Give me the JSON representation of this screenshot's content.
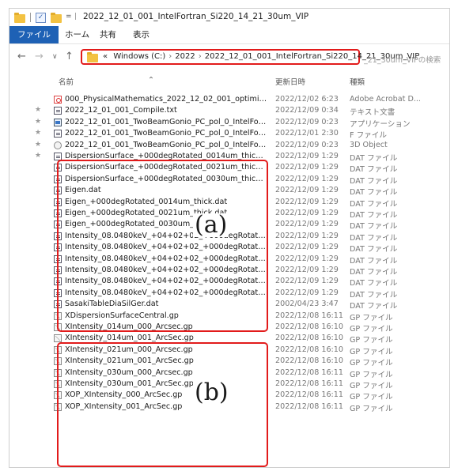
{
  "window": {
    "title": "2022_12_01_001_IntelFortran_Si220_14_21_30um_VIP",
    "quick_access_sep": "|",
    "quick_access_arrow": "="
  },
  "ribbon": {
    "tabs": [
      {
        "label": "ファイル",
        "active": true
      },
      {
        "label": "ホーム",
        "active": false
      },
      {
        "label": "共有",
        "active": false
      },
      {
        "label": "表示",
        "active": false
      }
    ]
  },
  "nav": {
    "back_icon": "←",
    "forward_icon": "→",
    "recent_icon": "∨",
    "up_icon": "↑",
    "address": {
      "overflow": "«",
      "segments": [
        "Windows (C:)",
        "2022",
        "2022_12_01_001_IntelFortran_Si220_14_21_30um_VIP"
      ],
      "separator": "›"
    },
    "search_placeholder": "_21_30um_VIPの検索"
  },
  "columns": {
    "name": "名前",
    "date": "更新日時",
    "type": "種類"
  },
  "files": [
    {
      "name": "000_PhysicalMathematics_2022_12_02_001_optimized.pdf",
      "date": "2022/12/02 6:23",
      "type": "Adobe Acrobat D...",
      "icon": "pdf-icon",
      "pinned": false
    },
    {
      "name": "2022_12_01_001_Compile.txt",
      "date": "2022/12/09 0:34",
      "type": "テキスト文書",
      "icon": "txt-icon",
      "pinned": true
    },
    {
      "name": "2022_12_01_001_TwoBeamGonio_PC_pol_0_IntelFortMKL.exe",
      "date": "2022/12/09 0:23",
      "type": "アプリケーション",
      "icon": "exe-icon",
      "pinned": true
    },
    {
      "name": "2022_12_01_001_TwoBeamGonio_PC_pol_0_IntelFortMKL.f",
      "date": "2022/12/01 2:30",
      "type": "F ファイル",
      "icon": "f-icon",
      "pinned": true
    },
    {
      "name": "2022_12_01_001_TwoBeamGonio_PC_pol_0_IntelFortMKL.obj",
      "date": "2022/12/09 0:23",
      "type": "3D Object",
      "icon": "obj-icon",
      "pinned": true
    },
    {
      "name": "DispersionSurface_+000degRotated_0014um_thick.dat",
      "date": "2022/12/09 1:29",
      "type": "DAT ファイル",
      "icon": "dat-icon",
      "pinned": true
    },
    {
      "name": "DispersionSurface_+000degRotated_0021um_thick.dat",
      "date": "2022/12/09 1:29",
      "type": "DAT ファイル",
      "icon": "dat-icon",
      "pinned": false
    },
    {
      "name": "DispersionSurface_+000degRotated_0030um_thick.dat",
      "date": "2022/12/09 1:29",
      "type": "DAT ファイル",
      "icon": "dat-icon",
      "pinned": false
    },
    {
      "name": "Eigen.dat",
      "date": "2022/12/09 1:29",
      "type": "DAT ファイル",
      "icon": "dat-icon",
      "pinned": false
    },
    {
      "name": "Eigen_+000degRotated_0014um_thick.dat",
      "date": "2022/12/09 1:29",
      "type": "DAT ファイル",
      "icon": "dat-icon",
      "pinned": false
    },
    {
      "name": "Eigen_+000degRotated_0021um_thick.dat",
      "date": "2022/12/09 1:29",
      "type": "DAT ファイル",
      "icon": "dat-icon",
      "pinned": false
    },
    {
      "name": "Eigen_+000degRotated_0030um_thick.dat",
      "date": "2022/12/09 1:29",
      "type": "DAT ファイル",
      "icon": "dat-icon",
      "pinned": false
    },
    {
      "name": "Intensity_08.0480keV_+04+02+02_+000degRotated_0014um_t...",
      "date": "2022/12/09 1:29",
      "type": "DAT ファイル",
      "icon": "dat-icon",
      "pinned": false
    },
    {
      "name": "Intensity_08.0480keV_+04+02+02_+000degRotated_0014um_t...",
      "date": "2022/12/09 1:29",
      "type": "DAT ファイル",
      "icon": "dat-icon",
      "pinned": false
    },
    {
      "name": "Intensity_08.0480keV_+04+02+02_+000degRotated_0021um_t...",
      "date": "2022/12/09 1:29",
      "type": "DAT ファイル",
      "icon": "dat-icon",
      "pinned": false
    },
    {
      "name": "Intensity_08.0480keV_+04+02+02_+000degRotated_0021um_t...",
      "date": "2022/12/09 1:29",
      "type": "DAT ファイル",
      "icon": "dat-icon",
      "pinned": false
    },
    {
      "name": "Intensity_08.0480keV_+04+02+02_+000degRotated_0030um_t...",
      "date": "2022/12/09 1:29",
      "type": "DAT ファイル",
      "icon": "dat-icon",
      "pinned": false
    },
    {
      "name": "Intensity_08.0480keV_+04+02+02_+000degRotated_0030um_t...",
      "date": "2022/12/09 1:29",
      "type": "DAT ファイル",
      "icon": "dat-icon",
      "pinned": false
    },
    {
      "name": "SasakiTableDiaSilGer.dat",
      "date": "2002/04/23 3:47",
      "type": "DAT ファイル",
      "icon": "dat-icon",
      "pinned": false
    },
    {
      "name": "XDispersionSurfaceCentral.gp",
      "date": "2022/12/08 16:11",
      "type": "GP ファイル",
      "icon": "gp-icon",
      "pinned": false
    },
    {
      "name": "XIntensity_014um_000_Arcsec.gp",
      "date": "2022/12/08 16:10",
      "type": "GP ファイル",
      "icon": "gp-icon",
      "pinned": false
    },
    {
      "name": "XIntensity_014um_001_ArcSec.gp",
      "date": "2022/12/08 16:10",
      "type": "GP ファイル",
      "icon": "gp-icon",
      "pinned": false
    },
    {
      "name": "XIntensity_021um_000_Arcsec.gp",
      "date": "2022/12/08 16:10",
      "type": "GP ファイル",
      "icon": "gp-icon",
      "pinned": false
    },
    {
      "name": "XIntensity_021um_001_ArcSec.gp",
      "date": "2022/12/08 16:10",
      "type": "GP ファイル",
      "icon": "gp-icon",
      "pinned": false
    },
    {
      "name": "XIntensity_030um_000_Arcsec.gp",
      "date": "2022/12/08 16:11",
      "type": "GP ファイル",
      "icon": "gp-icon",
      "pinned": false
    },
    {
      "name": "XIntensity_030um_001_ArcSec.gp",
      "date": "2022/12/08 16:11",
      "type": "GP ファイル",
      "icon": "gp-icon",
      "pinned": false
    },
    {
      "name": "XOP_XIntensity_000_ArcSec.gp",
      "date": "2022/12/08 16:11",
      "type": "GP ファイル",
      "icon": "gp-icon",
      "pinned": false
    },
    {
      "name": "XOP_XIntensity_001_ArcSec.gp",
      "date": "2022/12/08 16:11",
      "type": "GP ファイル",
      "icon": "gp-icon",
      "pinned": false
    }
  ],
  "annotations": {
    "a_label": "(a)",
    "b_label": "(b)",
    "highlight_color": "#e21b1b"
  },
  "colors": {
    "accent": "#1e61b5",
    "folder": "#f3c242"
  }
}
